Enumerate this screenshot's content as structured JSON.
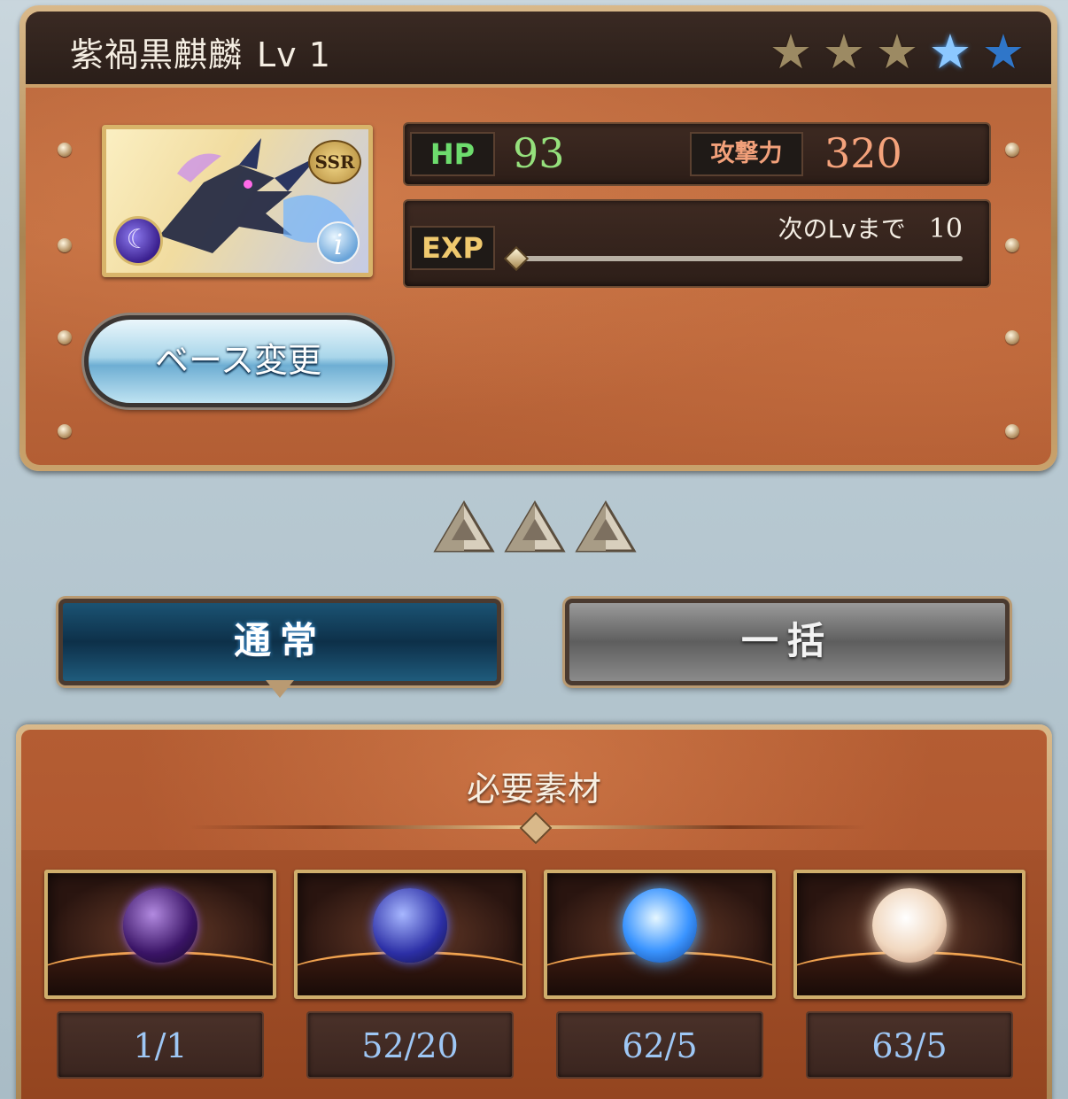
{
  "header": {
    "name": "紫禍黒麒麟",
    "level_text": "Lv 1",
    "stars": [
      {
        "type": "gold",
        "icon": "star-icon"
      },
      {
        "type": "gold",
        "icon": "star-icon"
      },
      {
        "type": "gold",
        "icon": "star-icon"
      },
      {
        "type": "blue-filled",
        "icon": "star-icon"
      },
      {
        "type": "blue-empty",
        "icon": "star-icon"
      }
    ]
  },
  "portrait": {
    "rarity": "SSR",
    "element_icon": "dark-element-icon",
    "info_icon": "info-icon",
    "info_glyph": "i",
    "element_glyph": "☾"
  },
  "base_change_label": "ベース変更",
  "stats": {
    "hp_label": "HP",
    "hp_value": "93",
    "atk_label": "攻撃力",
    "atk_value": "320",
    "exp_label": "EXP",
    "next_lv_label": "次のLvまで",
    "next_lv_value": "10",
    "exp_progress": 0.0
  },
  "uncap_level": 3,
  "modes": {
    "normal_label": "通常",
    "bulk_label": "一括",
    "selected": "normal"
  },
  "materials": {
    "title": "必要素材",
    "items": [
      {
        "count": "1/1",
        "icon": "dark-dragon-orb-icon"
      },
      {
        "count": "52/20",
        "icon": "violet-gem-icon"
      },
      {
        "count": "62/5",
        "icon": "blue-sphere-icon"
      },
      {
        "count": "63/5",
        "icon": "light-sphere-icon"
      }
    ]
  },
  "colors": {
    "hp": "#95e07c",
    "atk": "#f4a27b",
    "count": "#9ec7f5",
    "panel": "#b7643a"
  }
}
